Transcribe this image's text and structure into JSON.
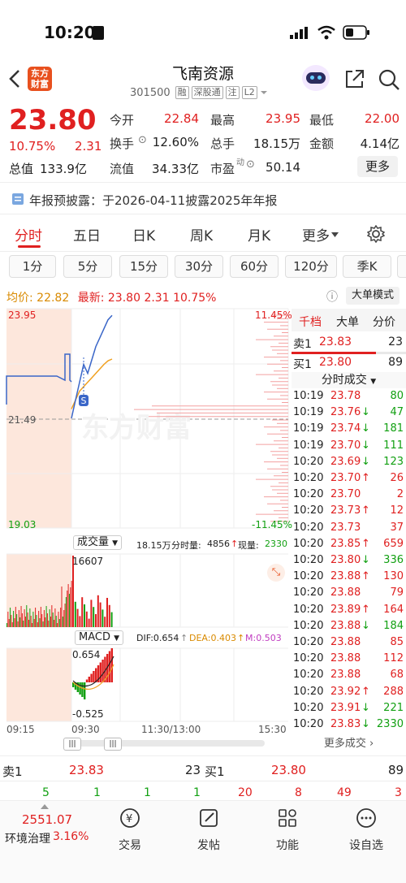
{
  "status": {
    "time": "10:20"
  },
  "header": {
    "title": "飞南资源",
    "code": "301500",
    "tags": [
      "融",
      "深股通",
      "注",
      "L2"
    ],
    "logo_text": "东方财富"
  },
  "quote": {
    "price": "23.80",
    "pct": "10.75%",
    "chg": "2.31",
    "labels": {
      "open": "今开",
      "high": "最高",
      "low": "最低",
      "turnover": "换手",
      "volume": "总手",
      "amount": "金额",
      "mktcap": "总值",
      "float": "流值",
      "pe": "市盈"
    },
    "values": {
      "open": "22.84",
      "high": "23.95",
      "low": "22.00",
      "turnover": "12.60%",
      "volume": "18.15万",
      "amount": "4.14亿",
      "mktcap": "133.9亿",
      "float": "34.33亿",
      "pe": "50.14"
    },
    "pe_sup": "动",
    "more": "更多"
  },
  "notice": {
    "label": "年报预披露：",
    "text": "于2026-04-11披露2025年年报"
  },
  "tabs": [
    "分时",
    "五日",
    "日K",
    "周K",
    "月K",
    "更多"
  ],
  "periods": [
    "1分",
    "5分",
    "15分",
    "30分",
    "60分",
    "120分",
    "季K"
  ],
  "info": {
    "avg_label": "均价:",
    "avg": "22.82",
    "latest_label": "最新:",
    "latest": "23.80",
    "chg": "2.31",
    "pct": "10.75%",
    "mode": "大单模式"
  },
  "chart": {
    "ymax": "23.95",
    "ymid": "21.49",
    "ymin": "19.03",
    "pmax": "11.45%",
    "pmin": "-11.45%",
    "x_start": "09:15",
    "x_mid1": "09:30",
    "x_mid2": "11:30/13:00",
    "x_end": "15:30",
    "marker": "S",
    "watermark": "东方财富"
  },
  "volume": {
    "label": "成交量",
    "total": "18.15万",
    "fen_label": "分时量:",
    "fen": "4856",
    "xian_label": "现量:",
    "xian": "2330",
    "max": "16607"
  },
  "macd": {
    "label": "MACD",
    "dif": "DIF:0.654",
    "dea": "DEA:0.403",
    "m": "M:0.503",
    "max": "0.654",
    "min": "-0.525"
  },
  "chart_data": {
    "type": "line",
    "title": "",
    "xlabel": "",
    "ylabel": "",
    "ylim": [
      19.03,
      23.95
    ],
    "x": [
      "09:30",
      "09:31",
      "09:32",
      "09:33",
      "09:34",
      "09:35",
      "09:36",
      "09:37",
      "09:38",
      "09:39",
      "09:40"
    ],
    "series": [
      {
        "name": "最新",
        "values": [
          21.49,
          21.9,
          22.3,
          22.7,
          22.5,
          22.8,
          23.1,
          23.3,
          23.5,
          23.7,
          23.8
        ]
      },
      {
        "name": "均价",
        "values": [
          21.7,
          21.9,
          22.1,
          22.2,
          22.3,
          22.4,
          22.5,
          22.6,
          22.7,
          22.78,
          22.82
        ]
      }
    ]
  },
  "rp": {
    "tabs": [
      "千档",
      "大单",
      "分价"
    ],
    "sell1_label": "卖1",
    "sell1_price": "23.83",
    "sell1_vol": "23",
    "buy1_label": "买1",
    "buy1_price": "23.80",
    "buy1_vol": "89",
    "ticks_title": "分时成交",
    "more_ticks": "更多成交"
  },
  "ticks": [
    {
      "t": "10:19",
      "p": "23.78",
      "d": "",
      "v": "80",
      "vc": "green",
      "pc": "red"
    },
    {
      "t": "10:19",
      "p": "23.76",
      "d": "↓",
      "v": "47",
      "vc": "green",
      "pc": "red"
    },
    {
      "t": "10:19",
      "p": "23.74",
      "d": "↓",
      "v": "181",
      "vc": "green",
      "pc": "red"
    },
    {
      "t": "10:19",
      "p": "23.70",
      "d": "↓",
      "v": "111",
      "vc": "green",
      "pc": "red"
    },
    {
      "t": "10:20",
      "p": "23.69",
      "d": "↓",
      "v": "123",
      "vc": "green",
      "pc": "red"
    },
    {
      "t": "10:20",
      "p": "23.70",
      "d": "↑",
      "v": "26",
      "vc": "red",
      "pc": "red"
    },
    {
      "t": "10:20",
      "p": "23.70",
      "d": "",
      "v": "2",
      "vc": "red",
      "pc": "red"
    },
    {
      "t": "10:20",
      "p": "23.73",
      "d": "↑",
      "v": "12",
      "vc": "red",
      "pc": "red"
    },
    {
      "t": "10:20",
      "p": "23.73",
      "d": "",
      "v": "37",
      "vc": "red",
      "pc": "red"
    },
    {
      "t": "10:20",
      "p": "23.85",
      "d": "↑",
      "v": "659",
      "vc": "red",
      "pc": "red"
    },
    {
      "t": "10:20",
      "p": "23.80",
      "d": "↓",
      "v": "336",
      "vc": "green",
      "pc": "red"
    },
    {
      "t": "10:20",
      "p": "23.88",
      "d": "↑",
      "v": "130",
      "vc": "red",
      "pc": "red"
    },
    {
      "t": "10:20",
      "p": "23.88",
      "d": "",
      "v": "79",
      "vc": "red",
      "pc": "red"
    },
    {
      "t": "10:20",
      "p": "23.89",
      "d": "↑",
      "v": "164",
      "vc": "red",
      "pc": "red"
    },
    {
      "t": "10:20",
      "p": "23.88",
      "d": "↓",
      "v": "184",
      "vc": "green",
      "pc": "red"
    },
    {
      "t": "10:20",
      "p": "23.88",
      "d": "",
      "v": "85",
      "vc": "red",
      "pc": "red"
    },
    {
      "t": "10:20",
      "p": "23.88",
      "d": "",
      "v": "112",
      "vc": "red",
      "pc": "red"
    },
    {
      "t": "10:20",
      "p": "23.88",
      "d": "",
      "v": "68",
      "vc": "red",
      "pc": "red"
    },
    {
      "t": "10:20",
      "p": "23.92",
      "d": "↑",
      "v": "288",
      "vc": "red",
      "pc": "red"
    },
    {
      "t": "10:20",
      "p": "23.91",
      "d": "↓",
      "v": "221",
      "vc": "green",
      "pc": "red"
    },
    {
      "t": "10:20",
      "p": "23.83",
      "d": "↓",
      "v": "2330",
      "vc": "green",
      "pc": "red"
    }
  ],
  "bottom": {
    "sell1_label": "卖1",
    "sell1_price": "23.83",
    "sell1_vol": "23",
    "buy1_label": "买1",
    "buy1_price": "23.80",
    "buy1_vol": "89",
    "levels": [
      "5",
      "1",
      "1",
      "1",
      "20",
      "8",
      "49",
      "3"
    ]
  },
  "nav": {
    "index_value": "2551.07",
    "index_name": "环境治理",
    "index_pct": "3.16%",
    "items": [
      "交易",
      "发帖",
      "功能",
      "设自选"
    ]
  },
  "colors": {
    "up": "#e02020",
    "down": "#12a012",
    "accent": "#e8501e"
  }
}
